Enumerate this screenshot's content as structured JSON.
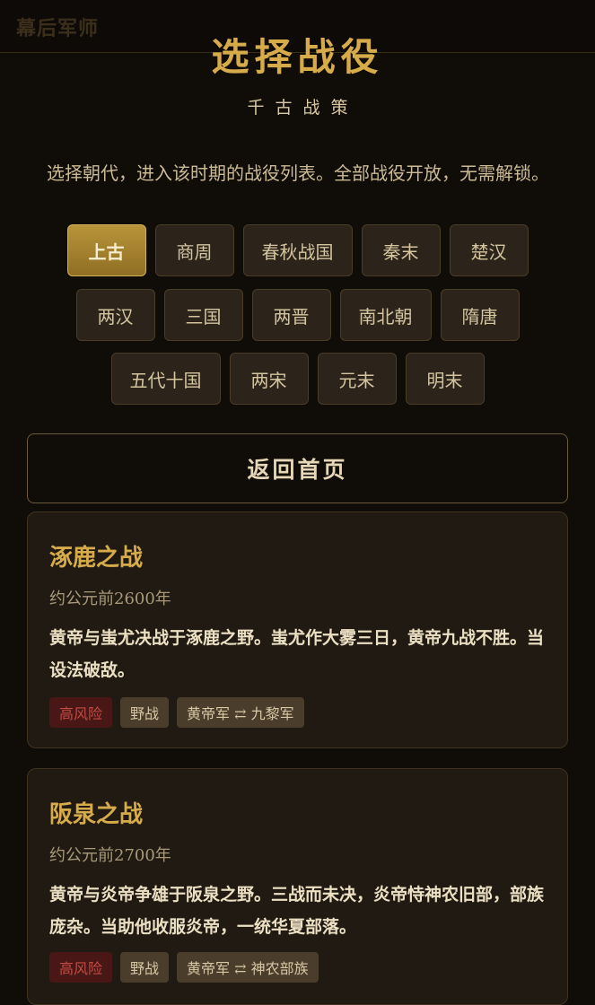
{
  "app": {
    "brand": "幕后军师"
  },
  "header": {
    "title": "选择战役",
    "subtitle": "千古战策",
    "intro": "选择朝代，进入该时期的战役列表。全部战役开放，无需解锁。"
  },
  "dynasties": {
    "selected": "上古",
    "row1": [
      "上古",
      "商周",
      "春秋战国",
      "秦末",
      "楚汉"
    ],
    "row2": [
      "两汉",
      "三国",
      "两晋",
      "南北朝",
      "隋唐"
    ],
    "row3": [
      "五代十国",
      "两宋",
      "元末",
      "明末"
    ]
  },
  "home_button": {
    "label": "返回首页"
  },
  "battles": [
    {
      "name": "涿鹿之战",
      "date": "约公元前2600年",
      "description": "黄帝与蚩尤决战于涿鹿之野。蚩尤作大雾三日，黄帝九战不胜。当设法破敌。",
      "tags": {
        "risk": "高风险",
        "type": "野战",
        "sides": "黄帝军 ⇄ 九黎军"
      }
    },
    {
      "name": "阪泉之战",
      "date": "约公元前2700年",
      "description": "黄帝与炎帝争雄于阪泉之野。三战而未决，炎帝恃神农旧部，部族庞杂。当助他收服炎帝，一统华夏部落。",
      "tags": {
        "risk": "高风险",
        "type": "野战",
        "sides": "黄帝军 ⇄ 神农部族"
      }
    }
  ]
}
